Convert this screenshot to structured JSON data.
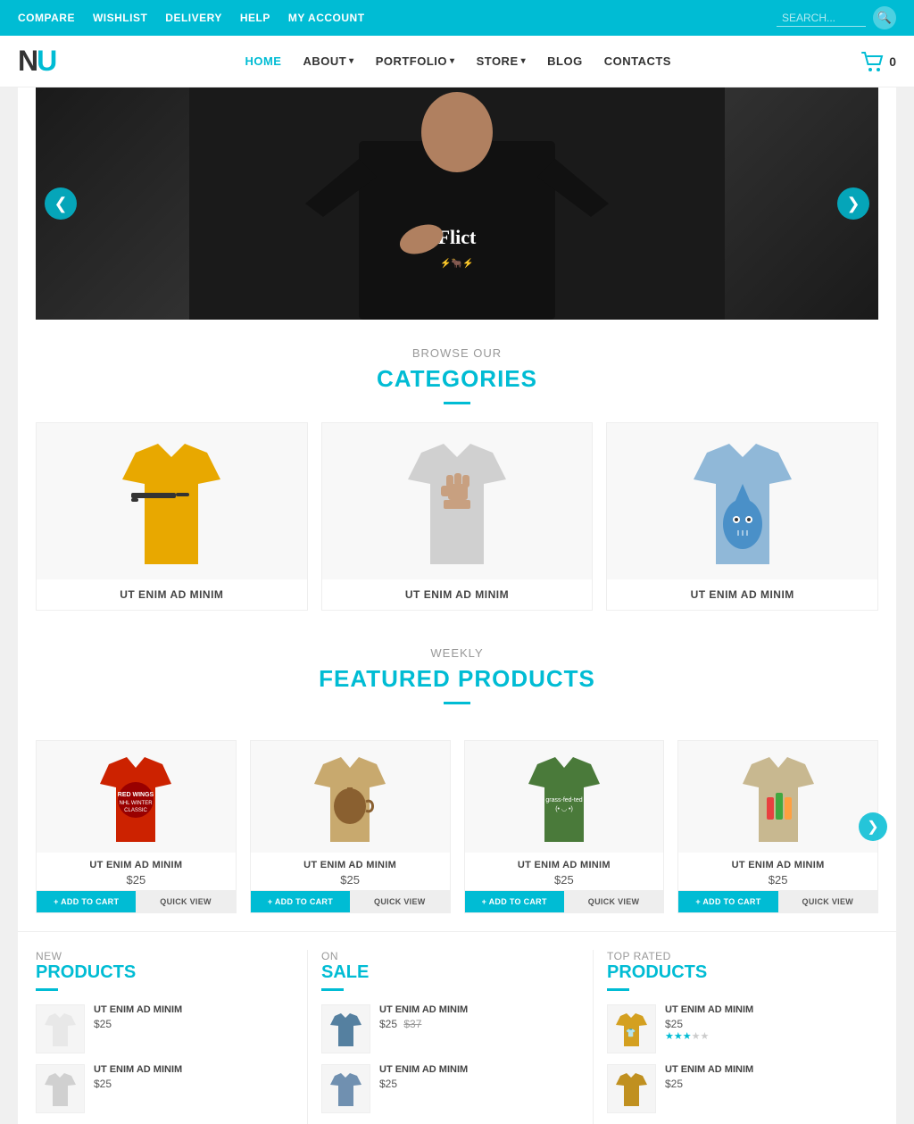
{
  "topbar": {
    "links": [
      "COMPARE",
      "WISHLIST",
      "DELIVERY",
      "HELP",
      "MY ACCOUNT"
    ],
    "search_placeholder": "SEARCH...",
    "search_icon": "🔍"
  },
  "header": {
    "logo_n": "N",
    "logo_u": "U",
    "nav": [
      {
        "label": "HOME",
        "active": true,
        "has_dropdown": false
      },
      {
        "label": "ABOUT",
        "active": false,
        "has_dropdown": true
      },
      {
        "label": "PORTFOLIO",
        "active": false,
        "has_dropdown": true
      },
      {
        "label": "STORE",
        "active": false,
        "has_dropdown": true
      },
      {
        "label": "BLOG",
        "active": false,
        "has_dropdown": false
      },
      {
        "label": "CONTACTS",
        "active": false,
        "has_dropdown": false
      }
    ],
    "cart_count": "0"
  },
  "hero": {
    "prev_label": "❮",
    "next_label": "❯"
  },
  "categories": {
    "sub": "BROWSE OUR",
    "title": "CATEGORIES",
    "items": [
      {
        "label": "UT ENIM AD MINIM",
        "shirt_color": "#e8a800",
        "graphic": "gun"
      },
      {
        "label": "UT ENIM AD MINIM",
        "shirt_color": "#c0c0c0",
        "graphic": "fist"
      },
      {
        "label": "UT ENIM AD MINIM",
        "shirt_color": "#90b8d8",
        "graphic": "drop"
      }
    ]
  },
  "featured": {
    "sub": "WEEKLY",
    "title": "FEATURED PRODUCTS",
    "products": [
      {
        "name": "UT ENIM AD MINIM",
        "price": "$25",
        "shirt_color": "#cc2200"
      },
      {
        "name": "UT ENIM AD MINIM",
        "price": "$25",
        "shirt_color": "#c8a96e"
      },
      {
        "name": "UT ENIM AD MINIM",
        "price": "$25",
        "shirt_color": "#4a7a3a"
      },
      {
        "name": "UT ENIM AD MINIM",
        "price": "$25",
        "shirt_color": "#c8b890"
      }
    ],
    "add_to_cart": "+ ADD TO CART",
    "quick_view": "QUICK VIEW",
    "next_btn": "❯"
  },
  "bottom": {
    "new_products": {
      "sub": "NEW",
      "title": "PRODUCTS",
      "items": [
        {
          "name": "UT ENIM AD MINIM",
          "price": "$25",
          "shirt_color": "#e8e8e8"
        },
        {
          "name": "UT ENIM AD MINIM",
          "price": "$25",
          "shirt_color": "#d0d0d0"
        }
      ]
    },
    "on_sale": {
      "sub": "ON",
      "title": "SALE",
      "items": [
        {
          "name": "UT ENIM AD MINIM",
          "price": "$25",
          "old_price": "$37",
          "shirt_color": "#5580a0"
        },
        {
          "name": "UT ENIM AD MINIM",
          "price": "$25",
          "old_price": "",
          "shirt_color": "#7090b0"
        }
      ]
    },
    "top_rated": {
      "sub": "TOP RATED",
      "title": "PRODUCTS",
      "items": [
        {
          "name": "UT ENIM AD MINIM",
          "price": "$25",
          "stars": 3,
          "shirt_color": "#d4a020"
        },
        {
          "name": "UT ENIM AD MINIM",
          "price": "$25",
          "stars": 0,
          "shirt_color": "#c09020"
        }
      ]
    }
  }
}
